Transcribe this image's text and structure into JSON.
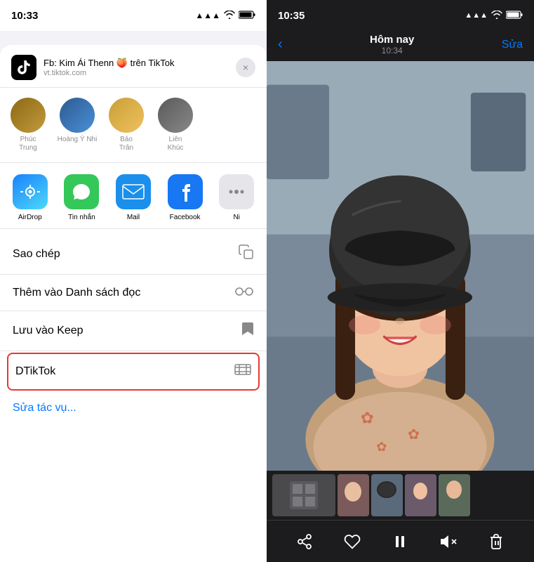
{
  "left_phone": {
    "status_bar": {
      "time": "10:33",
      "signal": "●●●",
      "wifi": "WiFi",
      "battery": "Battery"
    },
    "share_sheet": {
      "title": "Fb: Kim Ái Thenn 🍑 trên TikTok",
      "url": "vt.tiktok.com",
      "close_label": "×",
      "contacts": [
        {
          "name": "Phúc\nTrung",
          "color": "grad1"
        },
        {
          "name": "Hoàng Ý Nhi",
          "color": "grad2"
        },
        {
          "name": "Bảo\nTrân",
          "color": "grad3"
        },
        {
          "name": "Liên\nKhúc",
          "color": "grad4"
        }
      ],
      "apps": [
        {
          "label": "AirDrop",
          "icon_type": "airdrop"
        },
        {
          "label": "Tin nhắn",
          "icon_type": "messages"
        },
        {
          "label": "Mail",
          "icon_type": "mail"
        },
        {
          "label": "Facebook",
          "icon_type": "facebook"
        },
        {
          "label": "Ni",
          "icon_type": "other"
        }
      ],
      "actions": [
        {
          "label": "Sao chép",
          "icon": "📋",
          "highlighted": false
        },
        {
          "label": "Thêm vào Danh sách đọc",
          "icon": "👓",
          "highlighted": false
        },
        {
          "label": "Lưu vào Keep",
          "icon": "🔖",
          "highlighted": false
        },
        {
          "label": "DTikTok",
          "icon": "🎬",
          "highlighted": true
        }
      ],
      "edit_label": "Sửa tác vụ..."
    }
  },
  "right_phone": {
    "status_bar": {
      "time": "10:35"
    },
    "header": {
      "back_label": "‹",
      "date_label": "Hôm nay",
      "time_label": "10:34",
      "edit_label": "Sửa"
    },
    "toolbar": {
      "share_icon": "share",
      "heart_icon": "heart",
      "pause_icon": "pause",
      "mute_icon": "mute",
      "trash_icon": "trash"
    }
  }
}
